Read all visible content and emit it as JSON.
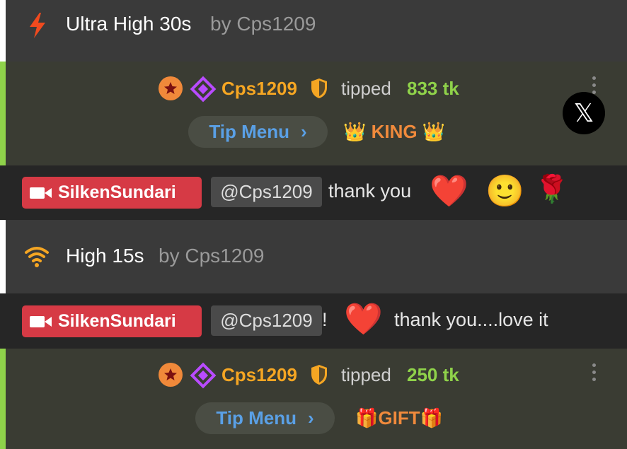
{
  "toys": [
    {
      "title": "Ultra High 30s",
      "by": "by",
      "user": "Cps1209",
      "icon": "lightning-icon"
    },
    {
      "title": "High 15s",
      "by": "by",
      "user": "Cps1209",
      "icon": "wifi-icon"
    }
  ],
  "tips": [
    {
      "user": "Cps1209",
      "tipped": "tipped",
      "amount": "833 tk",
      "menu": "Tip Menu",
      "label": "👑 KING 👑"
    },
    {
      "user": "Cps1209",
      "tipped": "tipped",
      "amount": "250 tk",
      "menu": "Tip Menu",
      "label": "🎁GIFT🎁"
    }
  ],
  "chats": [
    {
      "broadcaster": "SilkenSundari",
      "mention": "@Cps1209",
      "after_mention": "",
      "text": "thank you",
      "emojis": [
        "❤️",
        "🙂",
        "🌹"
      ]
    },
    {
      "broadcaster": "SilkenSundari",
      "mention": "@Cps1209",
      "after_mention": "!",
      "text": "thank you....love it",
      "emojis": [
        "❤️"
      ]
    }
  ],
  "x_button": "𝕏",
  "colors": {
    "username": "#f5a623",
    "amount": "#8fd24a",
    "tip_menu": "#5aa0e6",
    "broadcaster_badge": "#d63a45",
    "tip_border": "#8fd24a"
  }
}
